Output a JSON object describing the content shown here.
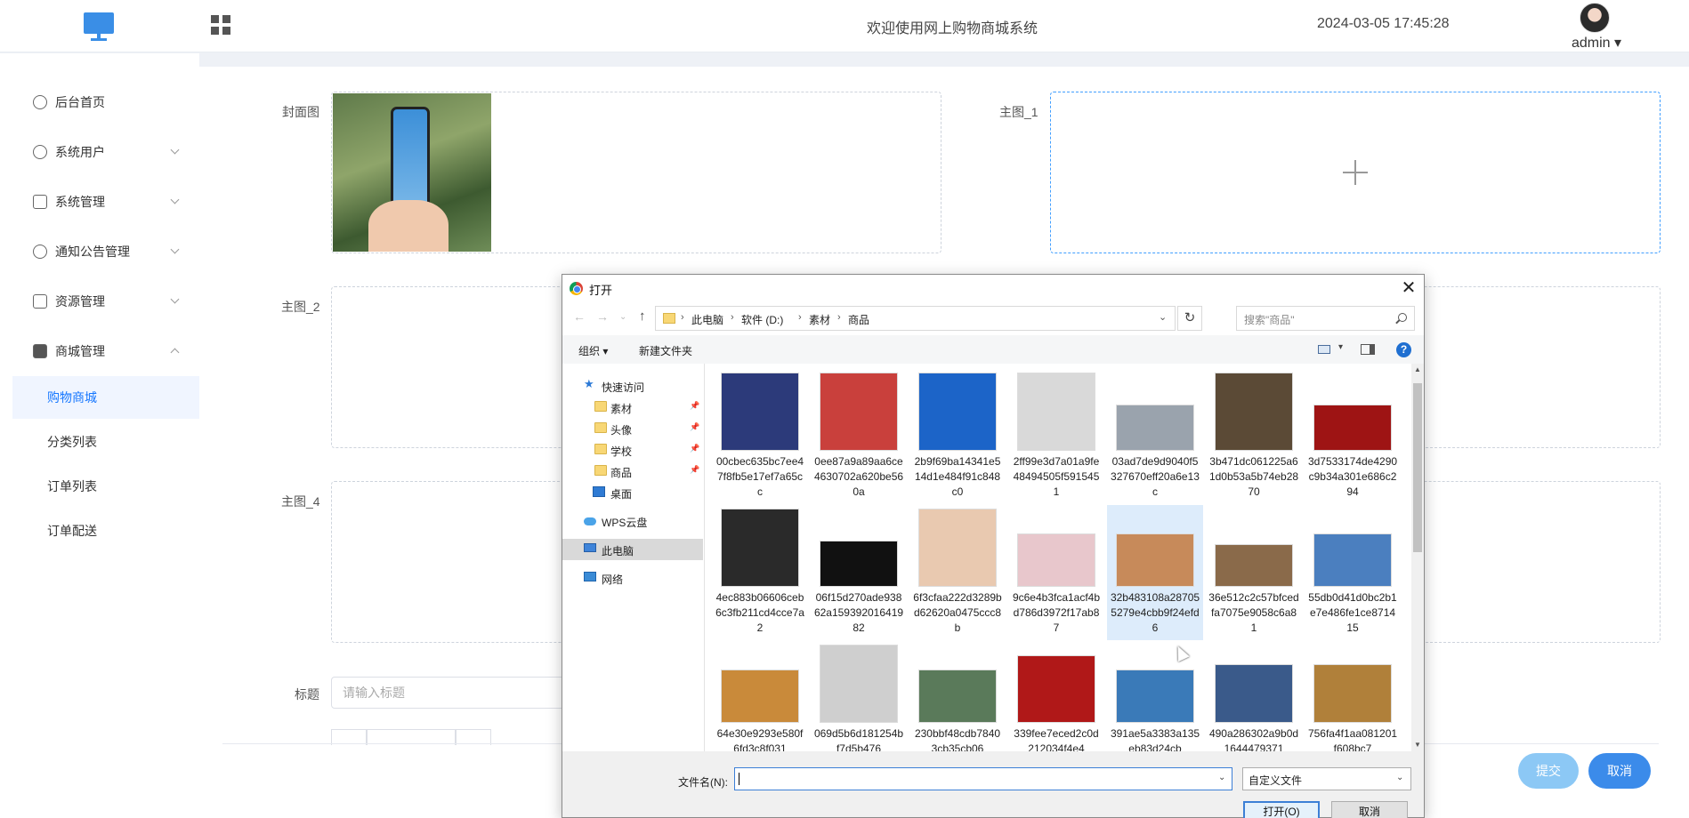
{
  "header": {
    "system_title": "欢迎使用网上购物商城系统",
    "datetime": "2024-03-05 17:45:28",
    "user": "admin ▾",
    "logo_icon": "monitor-icon",
    "apps_icon": "grid-icon"
  },
  "sidebar": {
    "items": [
      {
        "label": "后台首页",
        "icon": "clock-icon"
      },
      {
        "label": "系统用户",
        "icon": "user-icon"
      },
      {
        "label": "系统管理",
        "icon": "folder-icon"
      },
      {
        "label": "通知公告管理",
        "icon": "sparkle-icon"
      },
      {
        "label": "资源管理",
        "icon": "printer-icon"
      },
      {
        "label": "商城管理",
        "icon": "monitor-icon"
      }
    ],
    "submenu": [
      {
        "label": "购物商城"
      },
      {
        "label": "分类列表"
      },
      {
        "label": "订单列表"
      },
      {
        "label": "订单配送"
      }
    ]
  },
  "form": {
    "cover_label": "封面图",
    "main1_label": "主图_1",
    "main2_label": "主图_2",
    "main4_label": "主图_4",
    "title_label": "标题",
    "title_placeholder": "请输入标题",
    "submit": "提交",
    "cancel": "取消"
  },
  "dialog": {
    "title": "打开",
    "close": "✕",
    "breadcrumb": [
      "此电脑",
      "软件 (D:)",
      "素材",
      "商品"
    ],
    "search_placeholder": "搜索\"商品\"",
    "organize": "组织 ▾",
    "new_folder": "新建文件夹",
    "help": "?",
    "nav": {
      "quick_access": "快速访问",
      "folders": [
        "素材",
        "头像",
        "学校",
        "商品"
      ],
      "desktop": "桌面",
      "wps": "WPS云盘",
      "this_pc": "此电脑",
      "network": "网络"
    },
    "files": [
      {
        "name": "00cbec635bc7ee47f8fb5e17ef7a65cc",
        "color": "#2c3a7a"
      },
      {
        "name": "0ee87a9a89aa6ce4630702a620be560a",
        "color": "#c9403c"
      },
      {
        "name": "2b9f69ba14341e514d1e484f91c848c0",
        "color": "#1c64c8"
      },
      {
        "name": "2ff99e3d7a01a9fe48494505f5915451",
        "color": "#d9d9d9"
      },
      {
        "name": "03ad7de9d9040f5327670eff20a6e13c",
        "color": "#9aa3ad"
      },
      {
        "name": "3b471dc061225a61d0b53a5b74eb2870",
        "color": "#5b4a36"
      },
      {
        "name": "3d7533174de4290c9b34a301e686c294",
        "color": "#9e1414"
      },
      {
        "name": "4ec883b06606ceb6c3fb211cd4cce7a2",
        "color": "#2a2a2a"
      },
      {
        "name": "06f15d270ade93862a15939201641982",
        "color": "#111111"
      },
      {
        "name": "6f3cfaa222d3289bd62620a0475ccc8b",
        "color": "#e9c9b0"
      },
      {
        "name": "9c6e4b3fca1acf4bd786d3972f17ab87",
        "color": "#e8c7cc"
      },
      {
        "name": "32b483108a287055279e4cbb9f24efd6",
        "color": "#c78a5a"
      },
      {
        "name": "36e512c2c57bfcedfa7075e9058c6a81",
        "color": "#8a6a4a"
      },
      {
        "name": "55db0d41d0bc2b1e7e486fe1ce871415",
        "color": "#4b7fbf"
      },
      {
        "name": "64e30e9293e580f6fd3c8f031",
        "color": "#c98a3a"
      },
      {
        "name": "069d5b6d181254bf7d5b476",
        "color": "#cfcfcf"
      },
      {
        "name": "230bbf48cdb78403cb35cb06",
        "color": "#5a7a5a"
      },
      {
        "name": "339fee7eced2c0d212034f4e4",
        "color": "#b01818"
      },
      {
        "name": "391ae5a3383a135eb83d24cb",
        "color": "#3a7ab8"
      },
      {
        "name": "490a286302a9b0d1644479371",
        "color": "#3a5a8a"
      },
      {
        "name": "756fa4f1aa081201f608bc7",
        "color": "#b0803a"
      }
    ],
    "filename_label": "文件名(N):",
    "file_type": "自定义文件",
    "open_btn": "打开(O)",
    "cancel_btn": "取消"
  }
}
